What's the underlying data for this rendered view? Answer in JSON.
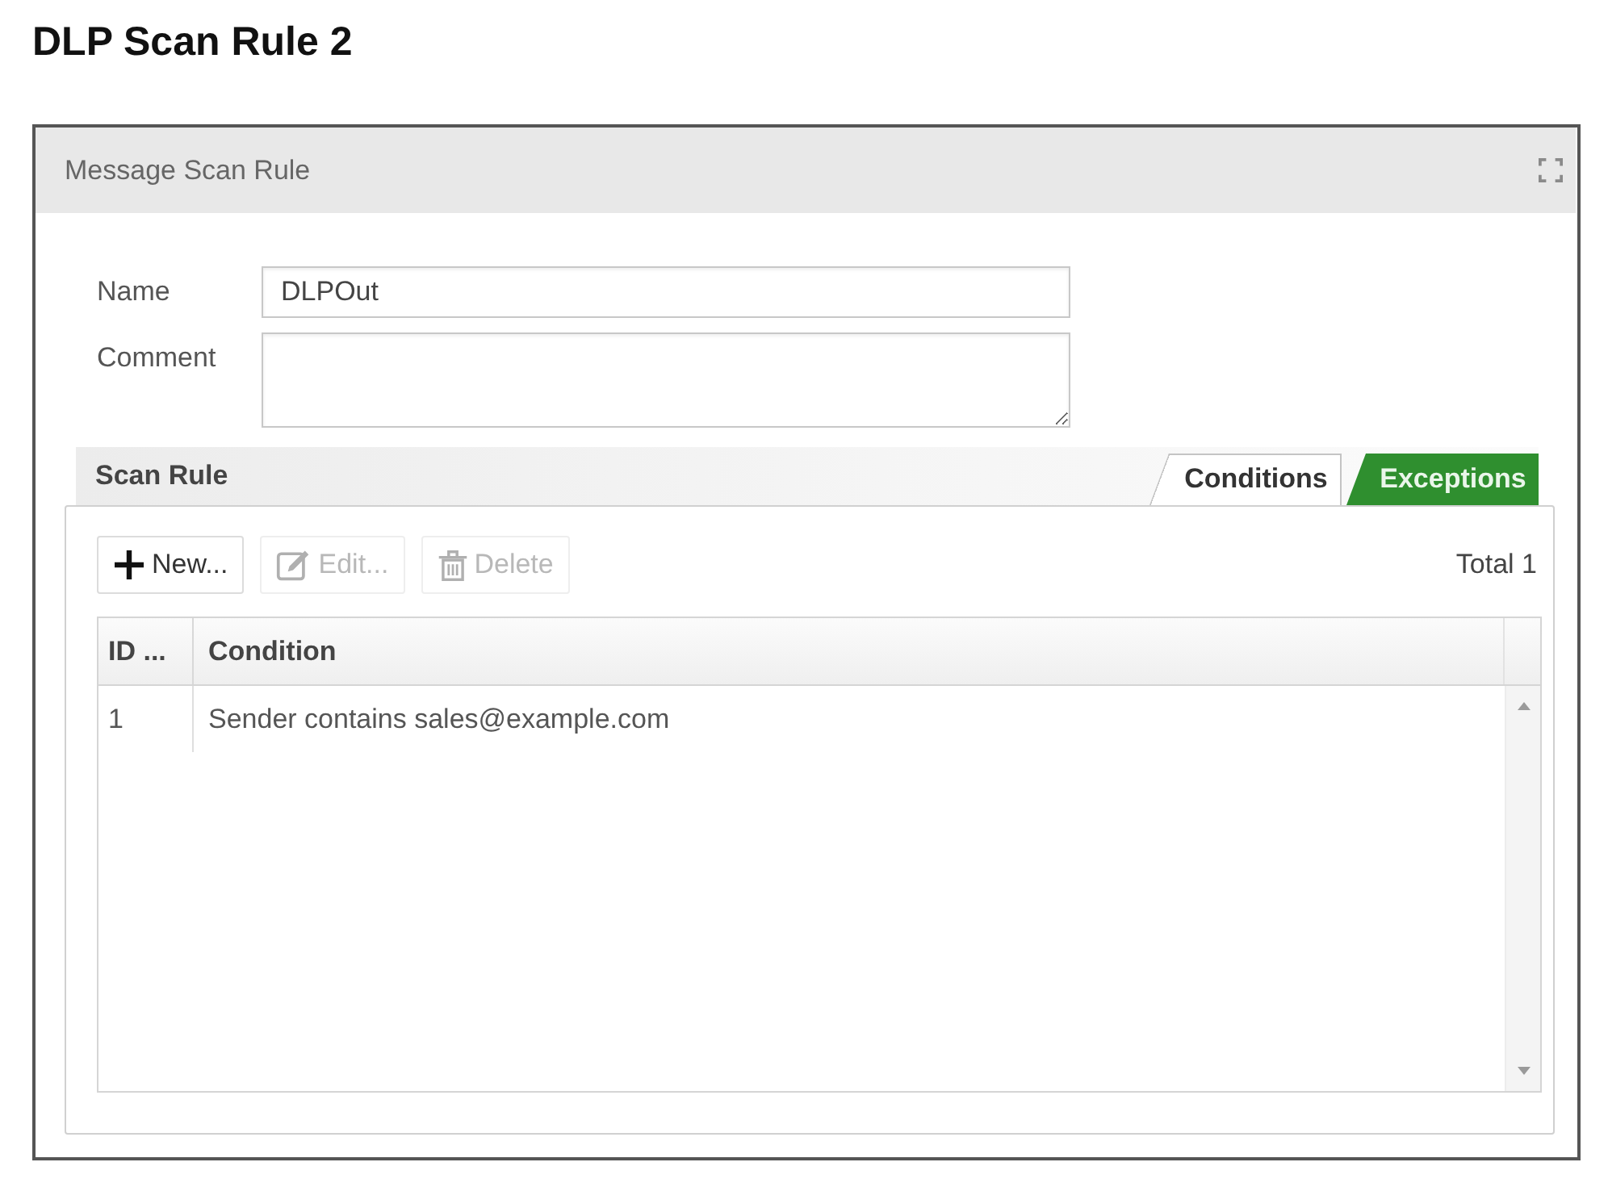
{
  "page_title": "DLP Scan Rule 2",
  "dialog": {
    "title": "Message Scan Rule",
    "fields": [
      {
        "label": "Name",
        "kind": "text",
        "value": "DLPOut"
      },
      {
        "label": "Comment",
        "kind": "textarea"
      }
    ],
    "scan_rule": {
      "title": "Scan Rule",
      "tabs": [
        {
          "label": "Conditions",
          "selected": false
        },
        {
          "label": "Exceptions",
          "selected": true
        }
      ],
      "toolbar": [
        {
          "kind": "new",
          "label": "New...",
          "disabled": false
        },
        {
          "kind": "edit",
          "label": "Edit...",
          "disabled": true
        },
        {
          "kind": "delete",
          "label": "Delete",
          "disabled": true
        }
      ],
      "total": "Total 1",
      "table": {
        "columns": [
          "ID ...",
          "Condition"
        ],
        "rows": [
          [
            "1",
            "Sender contains sales@example.com"
          ]
        ]
      }
    }
  }
}
